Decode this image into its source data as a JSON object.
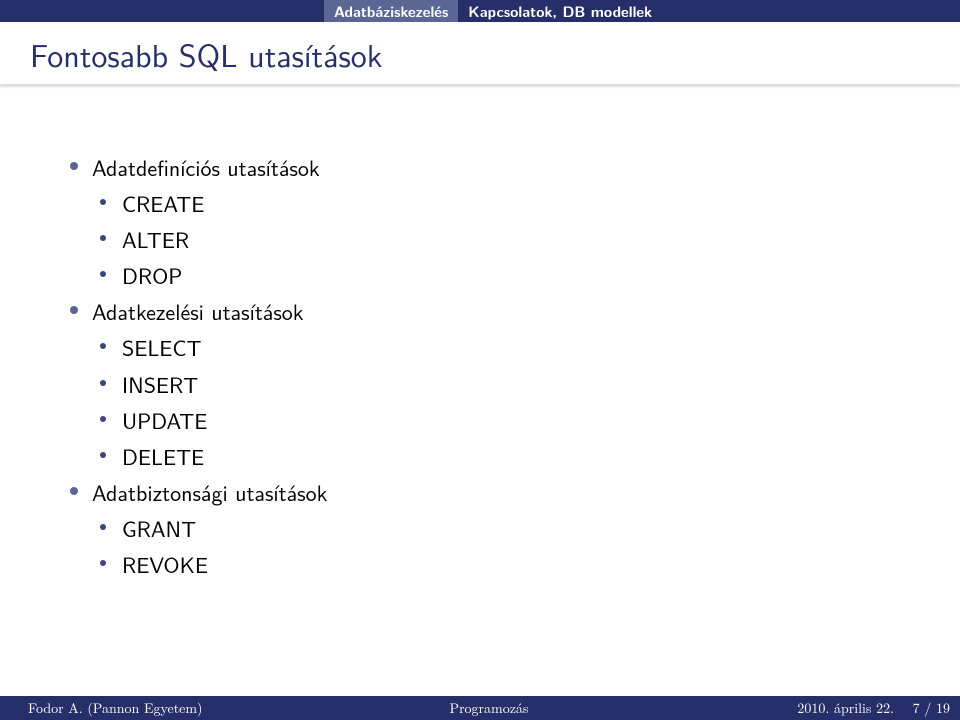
{
  "nav": {
    "section": "Adatbáziskezelés",
    "subsection": "Kapcsolatok, DB modellek"
  },
  "title": "Fontosabb SQL utasítások",
  "content": {
    "groups": [
      {
        "label": "Adatdefiníciós utasítások",
        "items": [
          "CREATE",
          "ALTER",
          "DROP"
        ]
      },
      {
        "label": "Adatkezelési utasítások",
        "items": [
          "SELECT",
          "INSERT",
          "UPDATE",
          "DELETE"
        ]
      },
      {
        "label": "Adatbiztonsági utasítások",
        "items": [
          "GRANT",
          "REVOKE"
        ]
      }
    ]
  },
  "footer": {
    "author": "Fodor A. (Pannon Egyetem)",
    "course": "Programozás",
    "date": "2010. április 22.",
    "page": "7 / 19"
  }
}
